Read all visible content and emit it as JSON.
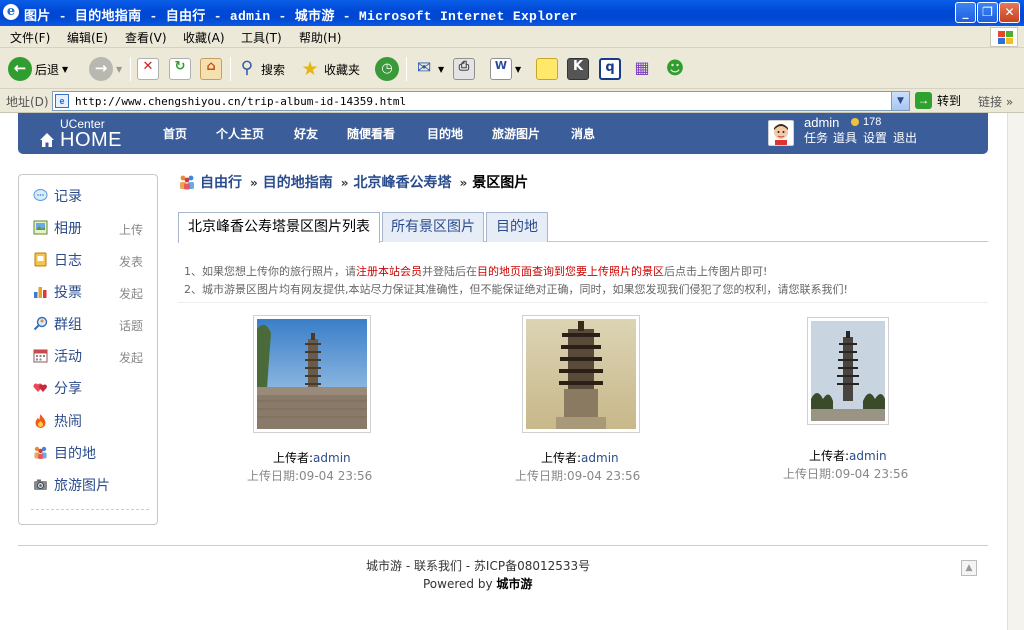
{
  "window": {
    "title": "图片 - 目的地指南 - 自由行 - admin - 城市游 - Microsoft Internet Explorer",
    "minimize": "_",
    "restore": "❐",
    "close": "✕"
  },
  "menu": [
    "文件(F)",
    "编辑(E)",
    "查看(V)",
    "收藏(A)",
    "工具(T)",
    "帮助(H)"
  ],
  "toolbar": {
    "back": "后退",
    "search": "搜索",
    "favorites": "收藏夹"
  },
  "address": {
    "label": "地址(D)",
    "url": "http://www.chengshiyou.cn/trip-album-id-14359.html",
    "go": "转到",
    "links": "链接"
  },
  "site": {
    "logo_small": "UCenter",
    "logo_big": "HOME",
    "nav": [
      "首页",
      "个人主页",
      "好友",
      "随便看看",
      "目的地",
      "旅游图片",
      "消息"
    ],
    "user": {
      "name": "admin",
      "credits": "178",
      "links": [
        "任务",
        "道具",
        "设置",
        "退出"
      ]
    }
  },
  "sidebar": [
    {
      "label": "记录",
      "action": ""
    },
    {
      "label": "相册",
      "action": "上传"
    },
    {
      "label": "日志",
      "action": "发表"
    },
    {
      "label": "投票",
      "action": "发起"
    },
    {
      "label": "群组",
      "action": "话题"
    },
    {
      "label": "活动",
      "action": "发起"
    },
    {
      "label": "分享",
      "action": ""
    },
    {
      "label": "热闹",
      "action": ""
    },
    {
      "label": "目的地",
      "action": ""
    },
    {
      "label": "旅游图片",
      "action": ""
    }
  ],
  "breadcrumb": {
    "items": [
      "自由行",
      "目的地指南",
      "北京峰香公寿塔"
    ],
    "current": "景区图片",
    "sep": "»"
  },
  "tabs": [
    "北京峰香公寿塔景区图片列表",
    "所有景区图片",
    "目的地"
  ],
  "notes": {
    "line1_a": "1、如果您想上传你的旅行照片，请",
    "line1_link1": "注册本站会员",
    "line1_b": "并登陆后在",
    "line1_link2": "目的地页面查询到您要上传照片的景区",
    "line1_c": "后点击上传图片即可!",
    "line2": "2、城市游景区图片均有网友提供,本站尽力保证其准确性，但不能保证绝对正确，同时，如果您发现我们侵犯了您的权利，请您联系我们!"
  },
  "photos": [
    {
      "uploader_label": "上传者:",
      "uploader": "admin",
      "date": "上传日期:09-04 23:56"
    },
    {
      "uploader_label": "上传者:",
      "uploader": "admin",
      "date": "上传日期:09-04 23:56"
    },
    {
      "uploader_label": "上传者:",
      "uploader": "admin",
      "date": "上传日期:09-04 23:56"
    }
  ],
  "footer": {
    "line1": "城市游 - 联系我们 - 苏ICP备08012533号",
    "powered": "Powered by ",
    "brand": "城市游"
  },
  "colors": {
    "header": "#3b5e9b",
    "link": "#2b4c8c",
    "notice_red": "#cc0000"
  }
}
